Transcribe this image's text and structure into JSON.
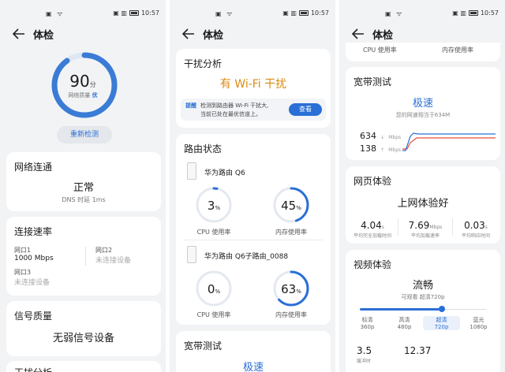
{
  "status": {
    "time": "10:57"
  },
  "p1": {
    "title": "体检",
    "score": "90",
    "score_unit": "分",
    "quality_label": "网络质量",
    "quality_value": "优",
    "recheck": "重新检测",
    "connectivity": {
      "title": "网络连通",
      "status": "正常",
      "dns": "DNS 时延 1ms"
    },
    "speed": {
      "title": "连接速率",
      "port1_label": "网口1",
      "port1_value": "1000 Mbps",
      "port2_label": "网口2",
      "port2_value": "未连接设备",
      "port3_label": "网口3",
      "port3_value": "未连接设备"
    },
    "signal": {
      "title": "信号质量",
      "status": "无弱信号设备"
    },
    "cutoff": "干扰分析"
  },
  "p2": {
    "title": "体检",
    "interference": {
      "title": "干扰分析",
      "status": "有 Wi-Fi 干扰",
      "tip_tag": "提醒",
      "tip_text_1": "检测到路由器 Wi-Fi 干扰大,",
      "tip_text_2": "当前已处在最优信道上。",
      "view": "查看"
    },
    "router_status": {
      "title": "路由状态",
      "router1": {
        "name": "华为路由 Q6",
        "cpu": "3",
        "mem": "45"
      },
      "router2": {
        "name": "华为路由 Q6子路由_0088",
        "cpu": "0",
        "mem": "63"
      },
      "pct": "%",
      "cpu_label": "CPU 使用率",
      "mem_label": "内存使用率"
    },
    "broadband": {
      "title": "宽带测试",
      "status": "极速"
    }
  },
  "p3": {
    "title": "体检",
    "cpu_label": "CPU 使用率",
    "mem_label": "内存使用率",
    "broadband": {
      "title": "宽带测试",
      "status": "极速",
      "desc": "您的网速相当于634M",
      "down": "634",
      "up": "138",
      "unit": "Mbps",
      "down_arrow": "↓",
      "up_arrow": "↑"
    },
    "web": {
      "title": "网页体验",
      "status": "上网体验好",
      "m1_value": "4.04",
      "m1_unit": "s",
      "m1_label": "平均完全加载时间",
      "m2_value": "7.69",
      "m2_unit": "Mbps",
      "m2_label": "平均加载速率",
      "m3_value": "0.03",
      "m3_unit": "s",
      "m3_label": "平均响应时间"
    },
    "video": {
      "title": "视频体验",
      "status": "流畅",
      "desc": "可观看 超清720p",
      "levels": [
        {
          "name": "标清",
          "res": "360p"
        },
        {
          "name": "高清",
          "res": "480p"
        },
        {
          "name": "超清",
          "res": "720p"
        },
        {
          "name": "蓝光",
          "res": "1080p"
        }
      ],
      "selected_index": 2,
      "m1_value": "3.5",
      "m1_label": "缓冲时",
      "m2_value": "12.37"
    }
  },
  "colors": {
    "accent": "#2a6fd6",
    "orange": "#d98a12",
    "ring_track": "#e4e9f0",
    "red_line": "#e0503c"
  }
}
